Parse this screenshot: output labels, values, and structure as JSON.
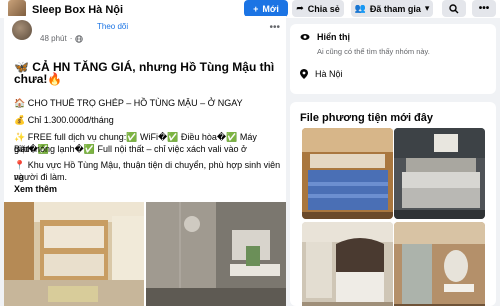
{
  "header": {
    "group_name": "Sleep Box Hà Nội",
    "new_label": "Mới",
    "share_label": "Chia sẻ",
    "joined_label": "Đã tham gia"
  },
  "post": {
    "follow_label": "Theo dõi",
    "time": "48 phút",
    "headline": "🦋 CẢ HN TĂNG GIÁ, nhưng Hồ Tùng Mậu thì chưa!🔥",
    "line1": "🏠 CHO THUÊ TRỌ GHÉP – HỒ TÙNG MẬU – Ở NGAY",
    "line2": "💰 Chỉ 1.300.000đ/tháng",
    "line3": "✨ FREE full dịch vụ chung:✅ WiFi�✅ Điều hòa�✅ Máy giặt�✅",
    "line4": "Bình nóng lạnh�✅ Full nội thất – chỉ việc xách vali vào ở",
    "line5": "📍 Khu vực Hồ Tùng Mậu, thuận tiện di chuyển, phù hợp sinh viên và",
    "line6": "người đi làm.",
    "see_more": "Xem thêm"
  },
  "about": {
    "visible_title": "Hiển thị",
    "visible_desc": "Ai cũng có thể tìm thấy nhóm này.",
    "location": "Hà Nội"
  },
  "media": {
    "title": "File phương tiện mới đây"
  },
  "colors": {
    "accent": "#1b74e4",
    "background": "#f0f2f5",
    "secondary_button": "#e4e6eb"
  }
}
